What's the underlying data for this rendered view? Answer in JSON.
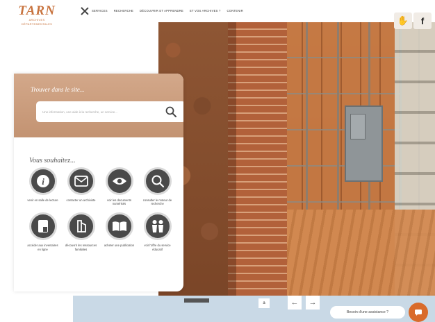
{
  "logo": {
    "main": "TARN",
    "sub1": "ARCHIVES",
    "sub2": "DÉPARTEMENTALES"
  },
  "nav": {
    "items": [
      "SERVICES",
      "RECHERCHE",
      "DÉCOUVRIR ET APPRENDRE",
      "ET VOS ARCHIVES ?",
      "CONTENIR"
    ]
  },
  "social": {
    "items": [
      {
        "icon": "hand-icon",
        "label": "✋"
      },
      {
        "icon": "facebook-icon",
        "label": "f"
      }
    ]
  },
  "search": {
    "title": "Trouver dans le site...",
    "placeholder": "Une information, une aide à la recherche, un service..."
  },
  "wishes": {
    "title": "Vous souhaitez...",
    "actions": [
      {
        "icon": "info-icon",
        "label": "venir en salle de lecture"
      },
      {
        "icon": "mail-icon",
        "label": "contacter un archiviste"
      },
      {
        "icon": "eye-icon",
        "label": "voir les documents numérisés"
      },
      {
        "icon": "magnifier-icon",
        "label": "consulter le moteur de recherche"
      },
      {
        "icon": "tablet-icon",
        "label": "accéder aux inventaires en ligne"
      },
      {
        "icon": "tools-icon",
        "label": "découvrir les ressources familiales"
      },
      {
        "icon": "book-icon",
        "label": "acheter une publication"
      },
      {
        "icon": "people-icon",
        "label": "voir l'offre du service éducatif"
      }
    ]
  },
  "bottom": {
    "dots": "a",
    "prev": "←",
    "next": "→",
    "assistance": "Besoin d'une assistance ?"
  },
  "colors": {
    "brand": "#c8733e",
    "search_bg": "#c39372",
    "action_circle": "#4a4a4a",
    "chat": "#d96b2b",
    "strip": "#c9d9e6"
  }
}
